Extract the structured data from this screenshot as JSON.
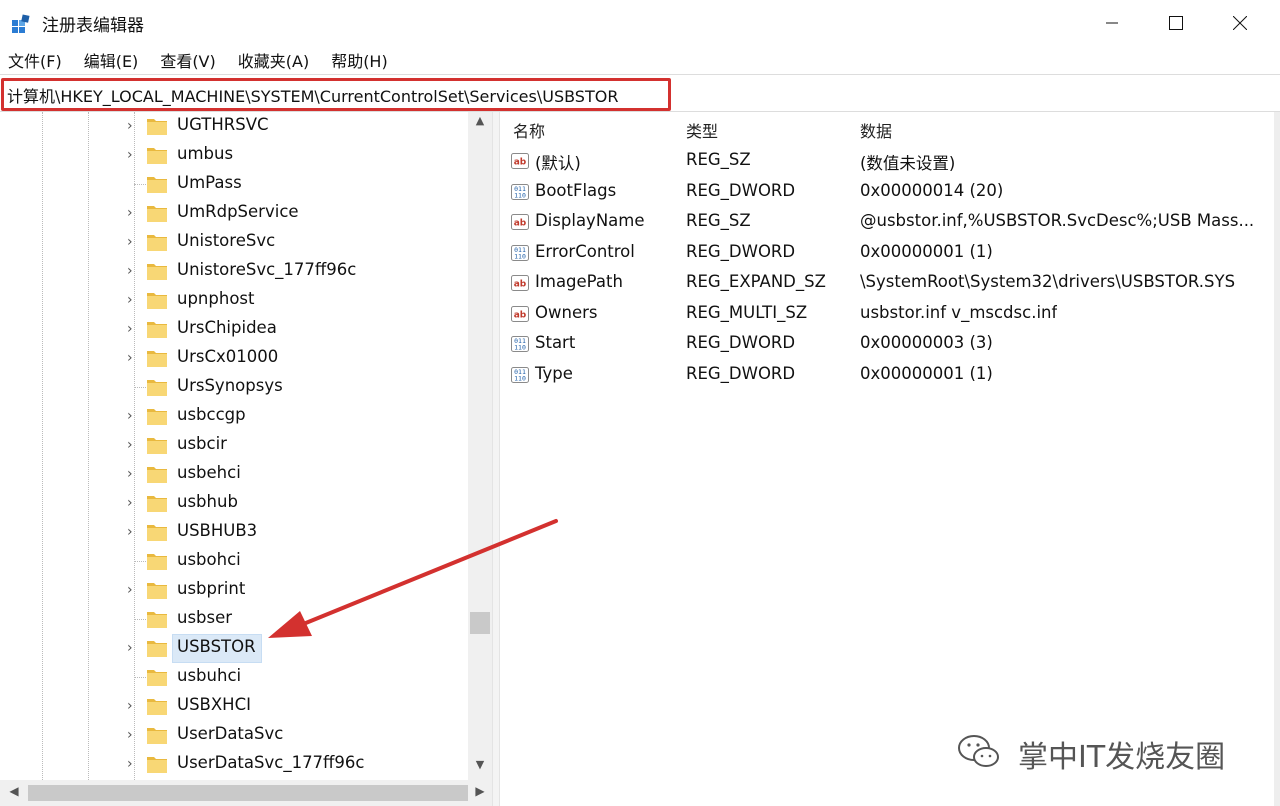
{
  "window": {
    "title": "注册表编辑器",
    "app_icon": "regedit-icon",
    "controls": [
      "minimize-icon",
      "maximize-icon",
      "close-icon"
    ]
  },
  "menu": [
    "文件(F)",
    "编辑(E)",
    "查看(V)",
    "收藏夹(A)",
    "帮助(H)"
  ],
  "address": {
    "path": "计算机\\HKEY_LOCAL_MACHINE\\SYSTEM\\CurrentControlSet\\Services\\USBSTOR",
    "highlight_color": "#d3312f"
  },
  "tree": {
    "items": [
      {
        "label": "UGTHRSVC",
        "expandable": true,
        "selected": false
      },
      {
        "label": "umbus",
        "expandable": true,
        "selected": false
      },
      {
        "label": "UmPass",
        "expandable": false,
        "selected": false
      },
      {
        "label": "UmRdpService",
        "expandable": true,
        "selected": false
      },
      {
        "label": "UnistoreSvc",
        "expandable": true,
        "selected": false
      },
      {
        "label": "UnistoreSvc_177ff96c",
        "expandable": true,
        "selected": false
      },
      {
        "label": "upnphost",
        "expandable": true,
        "selected": false
      },
      {
        "label": "UrsChipidea",
        "expandable": true,
        "selected": false
      },
      {
        "label": "UrsCx01000",
        "expandable": true,
        "selected": false
      },
      {
        "label": "UrsSynopsys",
        "expandable": false,
        "selected": false
      },
      {
        "label": "usbccgp",
        "expandable": true,
        "selected": false
      },
      {
        "label": "usbcir",
        "expandable": true,
        "selected": false
      },
      {
        "label": "usbehci",
        "expandable": true,
        "selected": false
      },
      {
        "label": "usbhub",
        "expandable": true,
        "selected": false
      },
      {
        "label": "USBHUB3",
        "expandable": true,
        "selected": false
      },
      {
        "label": "usbohci",
        "expandable": false,
        "selected": false
      },
      {
        "label": "usbprint",
        "expandable": true,
        "selected": false
      },
      {
        "label": "usbser",
        "expandable": false,
        "selected": false
      },
      {
        "label": "USBSTOR",
        "expandable": true,
        "selected": true
      },
      {
        "label": "usbuhci",
        "expandable": false,
        "selected": false
      },
      {
        "label": "USBXHCI",
        "expandable": true,
        "selected": false
      },
      {
        "label": "UserDataSvc",
        "expandable": true,
        "selected": false
      },
      {
        "label": "UserDataSvc_177ff96c",
        "expandable": true,
        "selected": false
      }
    ],
    "selection_color": "#dbe9f7",
    "folder_color": "#f4cf5d"
  },
  "values": {
    "columns": {
      "name": "名称",
      "type": "类型",
      "data": "数据"
    },
    "rows": [
      {
        "icon": "string-value-icon",
        "name": "(默认)",
        "type": "REG_SZ",
        "data": "(数值未设置)"
      },
      {
        "icon": "binary-value-icon",
        "name": "BootFlags",
        "type": "REG_DWORD",
        "data": "0x00000014 (20)"
      },
      {
        "icon": "string-value-icon",
        "name": "DisplayName",
        "type": "REG_SZ",
        "data": "@usbstor.inf,%USBSTOR.SvcDesc%;USB Mass..."
      },
      {
        "icon": "binary-value-icon",
        "name": "ErrorControl",
        "type": "REG_DWORD",
        "data": "0x00000001 (1)"
      },
      {
        "icon": "string-value-icon",
        "name": "ImagePath",
        "type": "REG_EXPAND_SZ",
        "data": "\\SystemRoot\\System32\\drivers\\USBSTOR.SYS"
      },
      {
        "icon": "string-value-icon",
        "name": "Owners",
        "type": "REG_MULTI_SZ",
        "data": "usbstor.inf v_mscdsc.inf"
      },
      {
        "icon": "binary-value-icon",
        "name": "Start",
        "type": "REG_DWORD",
        "data": "0x00000003 (3)"
      },
      {
        "icon": "binary-value-icon",
        "name": "Type",
        "type": "REG_DWORD",
        "data": "0x00000001 (1)"
      }
    ]
  },
  "annotation": {
    "arrow_color": "#d3312f",
    "points_to": "USBSTOR"
  },
  "watermark": {
    "text": "掌中IT发烧友圈",
    "icon": "wechat-logo-icon"
  }
}
